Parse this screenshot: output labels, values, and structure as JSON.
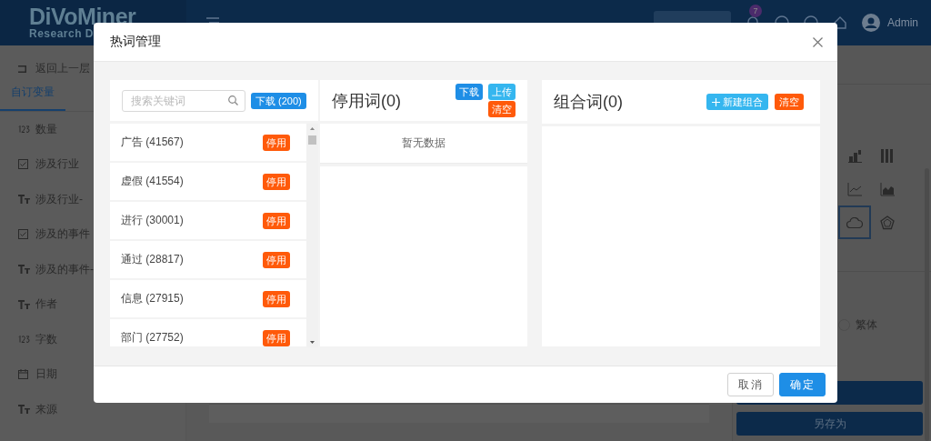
{
  "app": {
    "logo": {
      "name": "DiVoMiner",
      "tagline": "Research D"
    },
    "notification_count": "7",
    "user": "Admin",
    "back_link": "返回上一层",
    "tabs": [
      {
        "label": "自订变量",
        "selected": true
      }
    ],
    "variables": [
      {
        "kind": "number",
        "label": "数量"
      },
      {
        "kind": "checkbox",
        "label": "涉及行业"
      },
      {
        "kind": "text",
        "label": "涉及行业-"
      },
      {
        "kind": "checkbox",
        "label": "涉及的事件"
      },
      {
        "kind": "text",
        "label": "涉及的事件-"
      },
      {
        "kind": "text",
        "label": "作者"
      },
      {
        "kind": "number",
        "label": "字数"
      },
      {
        "kind": "date",
        "label": "日期"
      },
      {
        "kind": "text",
        "label": "来源"
      }
    ],
    "chart_types": [
      {
        "kind": "stacked",
        "selected": false
      },
      {
        "kind": "columns",
        "selected": false
      },
      {
        "kind": "line",
        "selected": false
      },
      {
        "kind": "area",
        "selected": false
      },
      {
        "kind": "cloud",
        "selected": true
      },
      {
        "kind": "radar",
        "selected": false
      }
    ],
    "script_option": {
      "label": "繁体",
      "selected": false
    },
    "save_as_button": "另存为"
  },
  "dialog": {
    "title": "热词管理",
    "search": {
      "placeholder": "搜索关键词"
    },
    "download_button": "下载 (200)",
    "words": [
      {
        "text": "广告 (41567)",
        "action": "停用"
      },
      {
        "text": "虚假 (41554)",
        "action": "停用"
      },
      {
        "text": "进行 (30001)",
        "action": "停用"
      },
      {
        "text": "通过 (28817)",
        "action": "停用"
      },
      {
        "text": "信息 (27915)",
        "action": "停用"
      },
      {
        "text": "部门 (27752)",
        "action": "停用"
      }
    ],
    "stopwords": {
      "title": "停用词(0)",
      "download_button": "下载",
      "upload_button": "上传",
      "clear_button": "清空",
      "empty_text": "暂无数据"
    },
    "combos": {
      "title": "组合词(0)",
      "new_button": "新建组合",
      "clear_button": "清空"
    },
    "cancel_button": "取消",
    "ok_button": "确定"
  }
}
